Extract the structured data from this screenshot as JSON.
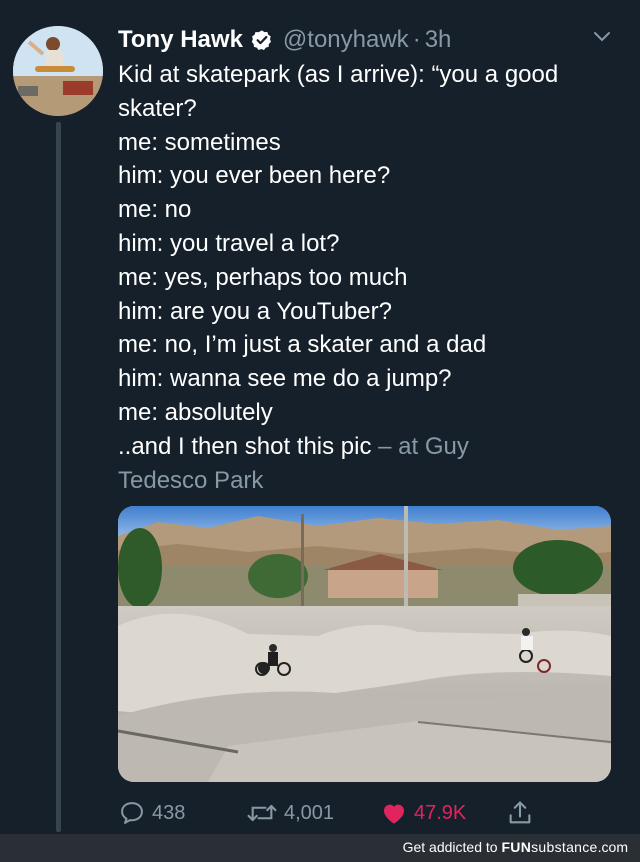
{
  "tweet": {
    "author_name": "Tony Hawk",
    "handle": "@tonyhawk",
    "separator": "·",
    "time": "3h",
    "lines": [
      "Kid at skatepark (as I arrive): “you a good",
      "skater?",
      "me: sometimes",
      "him: you ever been here?",
      "me: no",
      "him: you travel a lot?",
      "me: yes, perhaps too much",
      "him: are you a YouTuber?",
      "me: no, I’m just a skater and a dad",
      "him: wanna see me do a jump?",
      "me: absolutely"
    ],
    "last_line_text": "..and I then shot this pic",
    "location_prefix": " – at Guy",
    "location_rest": "Tedesco Park"
  },
  "actions": {
    "replies": "438",
    "retweets": "4,001",
    "likes": "47.9K"
  },
  "footer": {
    "prefix": "Get addicted to ",
    "brand_bold": "FUN",
    "brand_light": "substance",
    "suffix": ".com"
  },
  "colors": {
    "background": "#15202b",
    "secondary_text": "#8899a6",
    "like": "#e0245e",
    "verified": "#ffffff"
  },
  "icons": [
    "verified-badge-icon",
    "chevron-down-icon",
    "reply-icon",
    "retweet-icon",
    "heart-icon",
    "share-icon"
  ]
}
